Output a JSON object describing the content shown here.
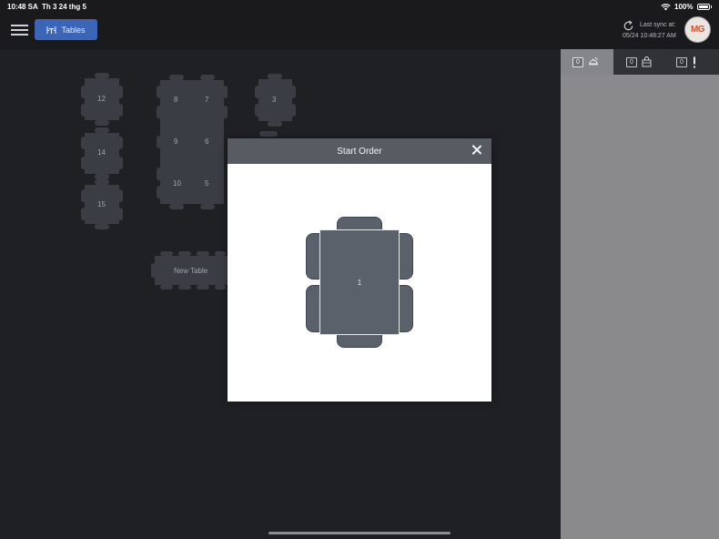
{
  "status_bar": {
    "time": "10:48 SA",
    "date": "Th 3 24 thg 5",
    "battery": "100%"
  },
  "header": {
    "tables_button": "Tables",
    "last_sync_label": "Last sync at:",
    "last_sync_time": "05/24 10:48:27 AM",
    "avatar_text": "MG"
  },
  "floor": {
    "tables": [
      "12",
      "14",
      "15",
      "8",
      "7",
      "9",
      "6",
      "10",
      "5",
      "3",
      "New Table"
    ]
  },
  "right_panel": {
    "tabs": [
      {
        "count": "0",
        "icon": "bell-hand-icon"
      },
      {
        "count": "0",
        "icon": "takeout-bag-icon"
      },
      {
        "count": "0",
        "icon": "exclamation-icon"
      }
    ]
  },
  "modal": {
    "title": "Start Order",
    "table_number": "1"
  },
  "colors": {
    "accent": "#3b66b7",
    "modal_header": "#575c63",
    "table_fill": "#5a616b"
  }
}
